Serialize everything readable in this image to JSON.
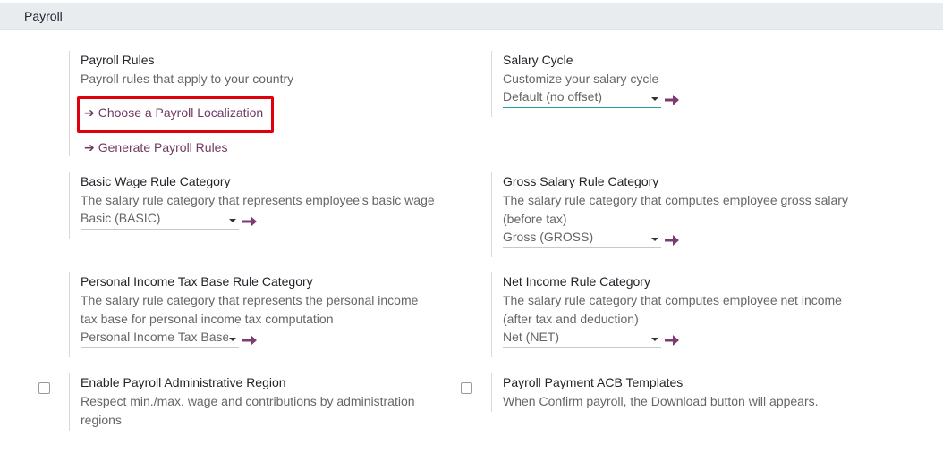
{
  "section": {
    "title": "Payroll"
  },
  "payroll_rules": {
    "title": "Payroll Rules",
    "desc": "Payroll rules that apply to your country",
    "link_localization": "Choose a Payroll Localization",
    "link_generate": "Generate Payroll Rules"
  },
  "salary_cycle": {
    "title": "Salary Cycle",
    "desc": "Customize your salary cycle",
    "value": "Default (no offset)"
  },
  "basic_wage": {
    "title": "Basic Wage Rule Category",
    "desc": "The salary rule category that represents employee's basic wage",
    "value": "Basic (BASIC)"
  },
  "gross_salary": {
    "title": "Gross Salary Rule Category",
    "desc_line1": "The salary rule category that computes employee gross salary",
    "desc_line2": "(before tax)",
    "value": "Gross (GROSS)"
  },
  "pit_base": {
    "title": "Personal Income Tax Base Rule Category",
    "desc_line1": "The salary rule category that represents the personal income",
    "desc_line2": "tax base for personal income tax computation",
    "value": "Personal Income Tax Base"
  },
  "net_income": {
    "title": "Net Income Rule Category",
    "desc_line1": "The salary rule category that computes employee net income",
    "desc_line2": "(after tax and deduction)",
    "value": "Net (NET)"
  },
  "admin_region": {
    "title": "Enable Payroll Administrative Region",
    "desc_line1": "Respect min./max. wage and contributions by administration",
    "desc_line2": "regions",
    "checked": false
  },
  "acb_templates": {
    "title": "Payroll Payment ACB Templates",
    "desc": "When Confirm payroll, the Download button will appears.",
    "checked": false
  },
  "colors": {
    "link": "#6f3a65",
    "arrow": "#7c3c72",
    "highlight": "#e0000b",
    "header_bg": "#e9ecef",
    "active_underline": "#20a1a1"
  },
  "icons": {
    "link_arrow": "arrow-right-icon",
    "go_button": "arrow-right-icon",
    "select_caret": "caret-down-icon"
  }
}
